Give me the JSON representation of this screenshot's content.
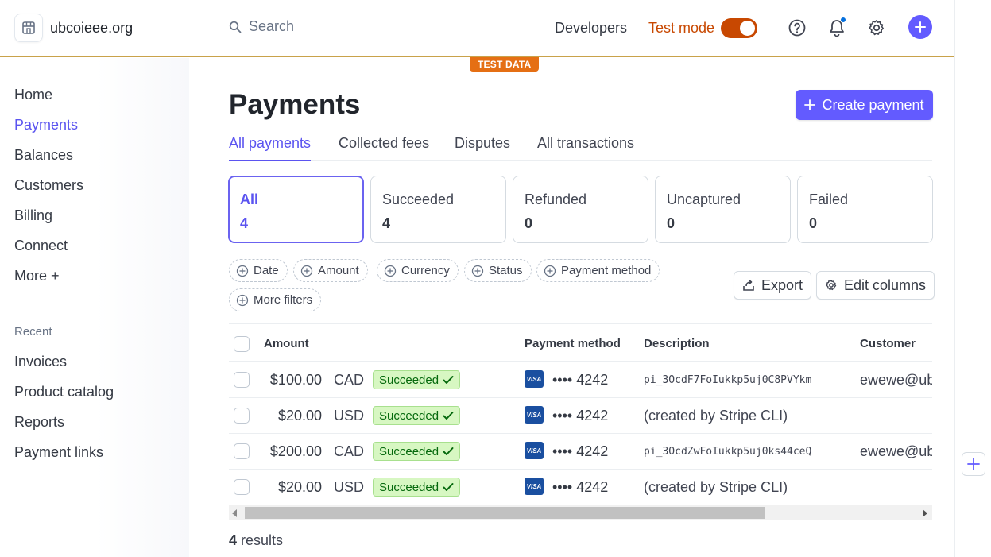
{
  "header": {
    "account_name": "ubcoieee.org",
    "search_placeholder": "Search",
    "developers": "Developers",
    "test_mode_label": "Test mode",
    "test_mode_on": true,
    "test_badge": "TEST DATA",
    "accent": "#635bff",
    "test_color": "#c84801"
  },
  "sidebar": {
    "items": [
      {
        "label": "Home",
        "active": false
      },
      {
        "label": "Payments",
        "active": true
      },
      {
        "label": "Balances",
        "active": false
      },
      {
        "label": "Customers",
        "active": false
      },
      {
        "label": "Billing",
        "active": false
      },
      {
        "label": "Connect",
        "active": false
      },
      {
        "label": "More +",
        "active": false
      }
    ],
    "recent_label": "Recent",
    "recent": [
      "Invoices",
      "Product catalog",
      "Reports",
      "Payment links"
    ]
  },
  "main": {
    "title": "Payments",
    "create_label": "Create payment",
    "tabs": [
      {
        "label": "All payments",
        "active": true
      },
      {
        "label": "Collected fees",
        "active": false
      },
      {
        "label": "Disputes",
        "active": false
      },
      {
        "label": "All transactions",
        "active": false
      }
    ],
    "status_cards": [
      {
        "label": "All",
        "count": "4",
        "active": true
      },
      {
        "label": "Succeeded",
        "count": "4",
        "active": false
      },
      {
        "label": "Refunded",
        "count": "0",
        "active": false
      },
      {
        "label": "Uncaptured",
        "count": "0",
        "active": false
      },
      {
        "label": "Failed",
        "count": "0",
        "active": false
      }
    ],
    "filters": [
      "Date",
      "Amount",
      "Currency",
      "Status",
      "Payment method",
      "More filters"
    ],
    "export_label": "Export",
    "edit_columns_label": "Edit columns",
    "columns": [
      "Amount",
      "Payment method",
      "Description",
      "Customer"
    ],
    "rows": [
      {
        "amount": "$100.00",
        "currency": "CAD",
        "status": "Succeeded",
        "card_brand": "VISA",
        "last4": "•••• 4242",
        "description": "pi_3OcdF7FoIukkp5uj0C8PVYkm",
        "desc_mono": true,
        "customer": "ewewe@ub"
      },
      {
        "amount": "$20.00",
        "currency": "USD",
        "status": "Succeeded",
        "card_brand": "VISA",
        "last4": "•••• 4242",
        "description": "(created by Stripe CLI)",
        "desc_mono": false,
        "customer": ""
      },
      {
        "amount": "$200.00",
        "currency": "CAD",
        "status": "Succeeded",
        "card_brand": "VISA",
        "last4": "•••• 4242",
        "description": "pi_3OcdZwFoIukkp5uj0ks44ceQ",
        "desc_mono": true,
        "customer": "ewewe@ub"
      },
      {
        "amount": "$20.00",
        "currency": "USD",
        "status": "Succeeded",
        "card_brand": "VISA",
        "last4": "•••• 4242",
        "description": "(created by Stripe CLI)",
        "desc_mono": false,
        "customer": ""
      }
    ],
    "results_count": "4",
    "results_word": "results"
  }
}
